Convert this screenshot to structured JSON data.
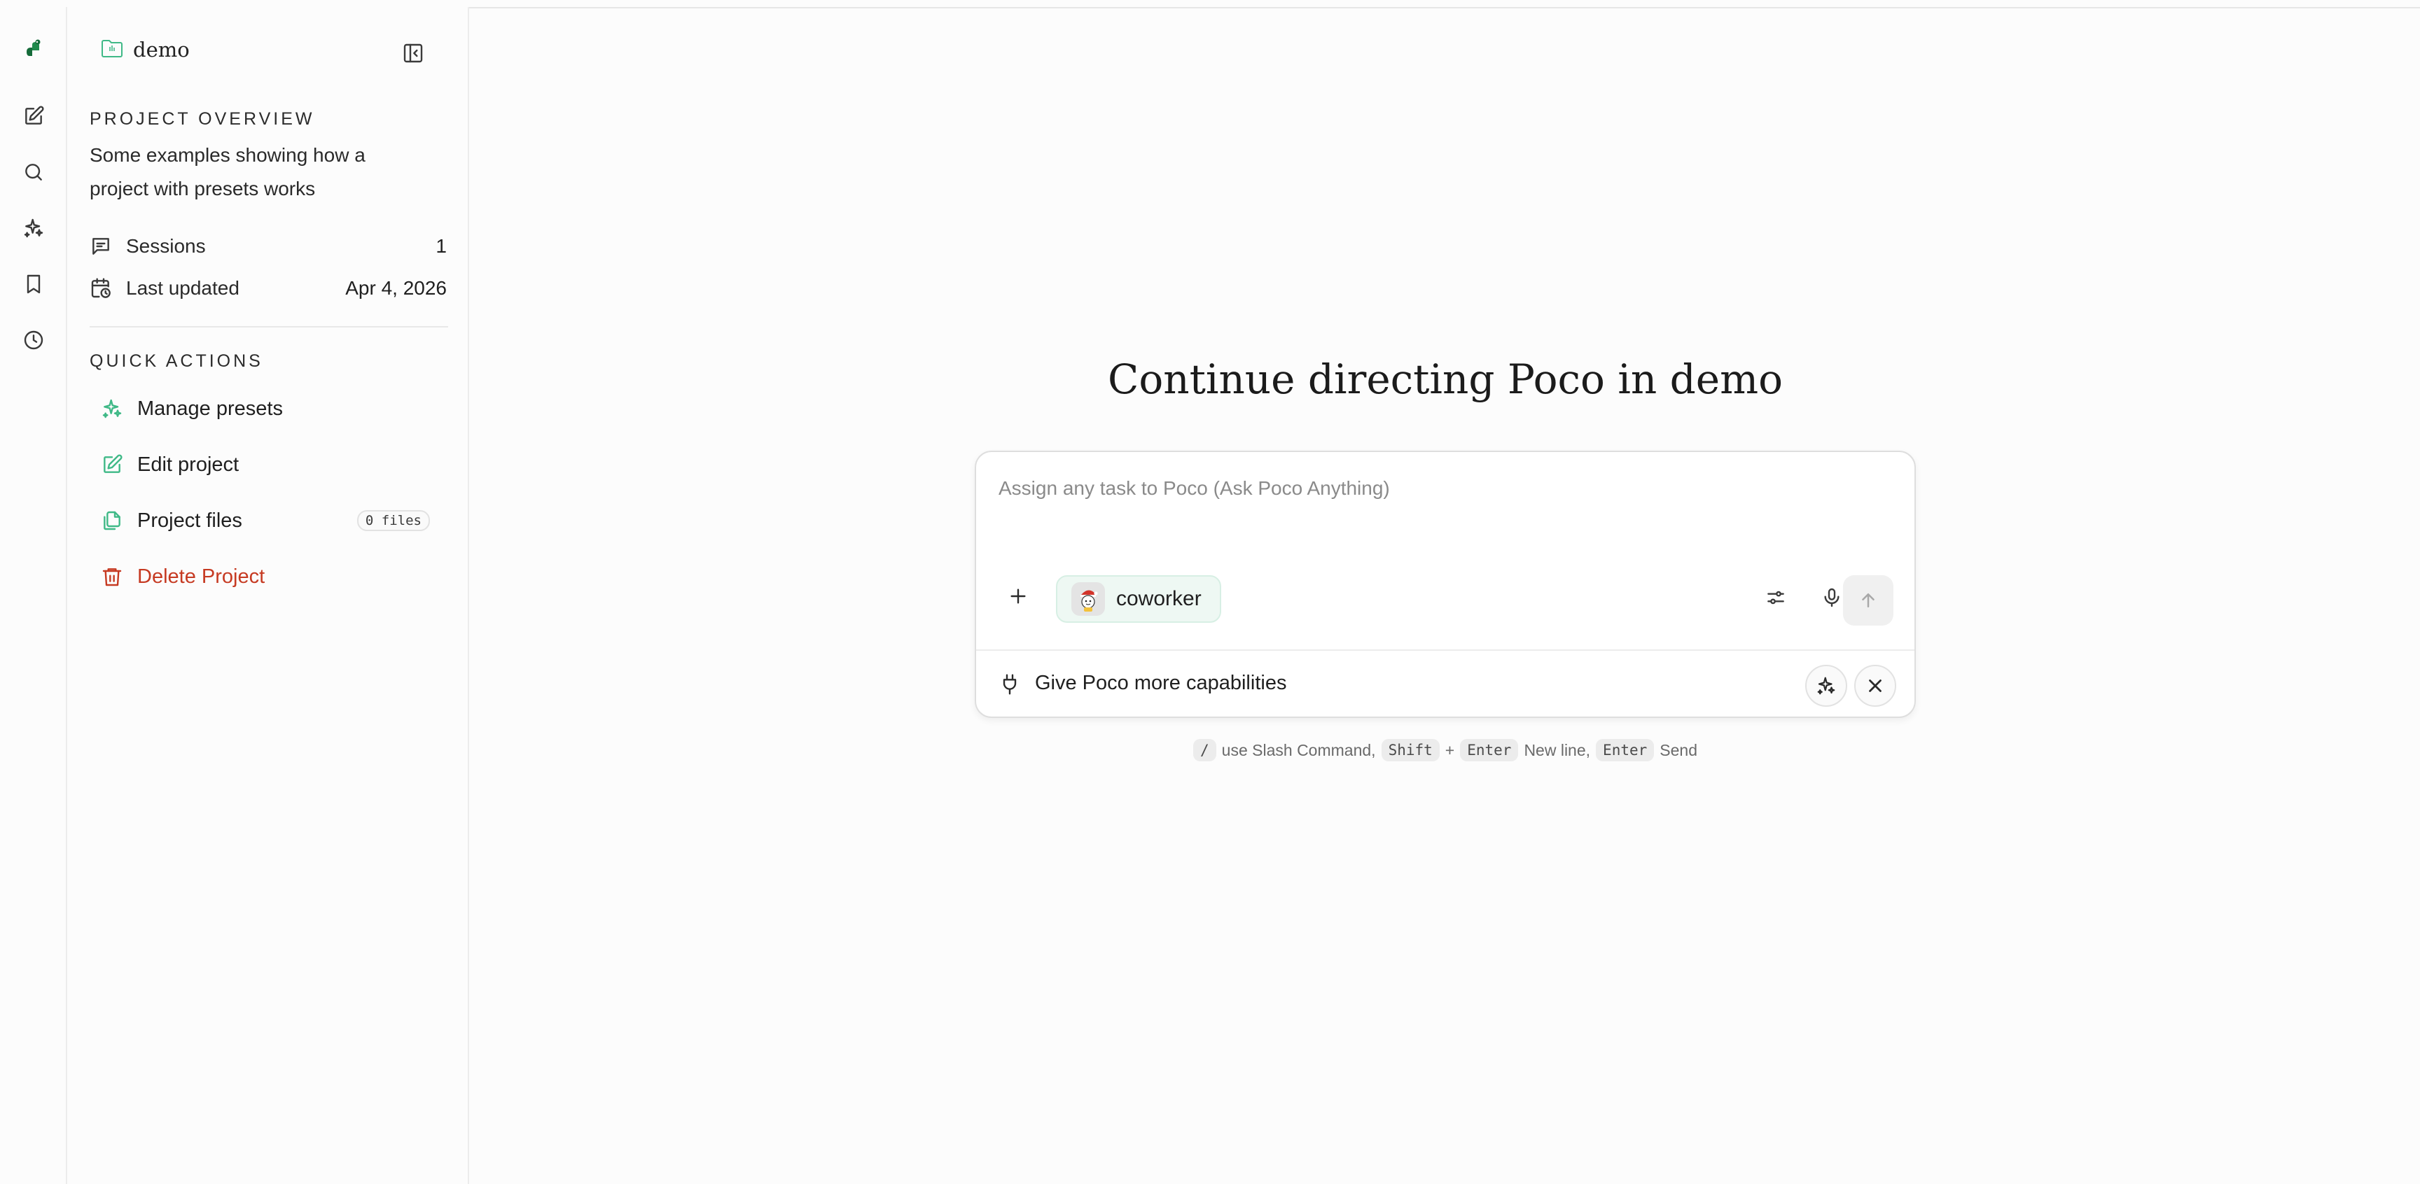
{
  "colors": {
    "accent": "#3fb987",
    "danger": "#c63a22",
    "brand": "#156b3a"
  },
  "rail": {
    "icons": [
      "app-logo-icon",
      "new-chat-icon",
      "search-icon",
      "presets-icon",
      "bookmark-icon",
      "history-icon"
    ]
  },
  "project": {
    "name": "demo",
    "overview_title": "PROJECT OVERVIEW",
    "description": "Some examples showing how a project with presets works",
    "stats": {
      "sessions_label": "Sessions",
      "sessions_value": "1",
      "updated_label": "Last updated",
      "updated_value": "Apr 4, 2026"
    }
  },
  "quick_actions": {
    "title": "QUICK ACTIONS",
    "manage_presets": "Manage presets",
    "edit_project": "Edit project",
    "project_files": "Project files",
    "files_badge": "0 files",
    "delete_project": "Delete Project"
  },
  "main": {
    "headline": "Continue directing Poco in demo",
    "composer": {
      "placeholder": "Assign any task to Poco (Ask Poco Anything)",
      "agent_name": "coworker",
      "capabilities_text": "Give Poco more capabilities"
    },
    "hint": {
      "slash_key": "/",
      "slash_text": "use Slash Command,",
      "shift_key": "Shift",
      "plus": "+",
      "enter_key": "Enter",
      "newline_text": "New line,",
      "enter_key2": "Enter",
      "send_text": "Send"
    }
  }
}
